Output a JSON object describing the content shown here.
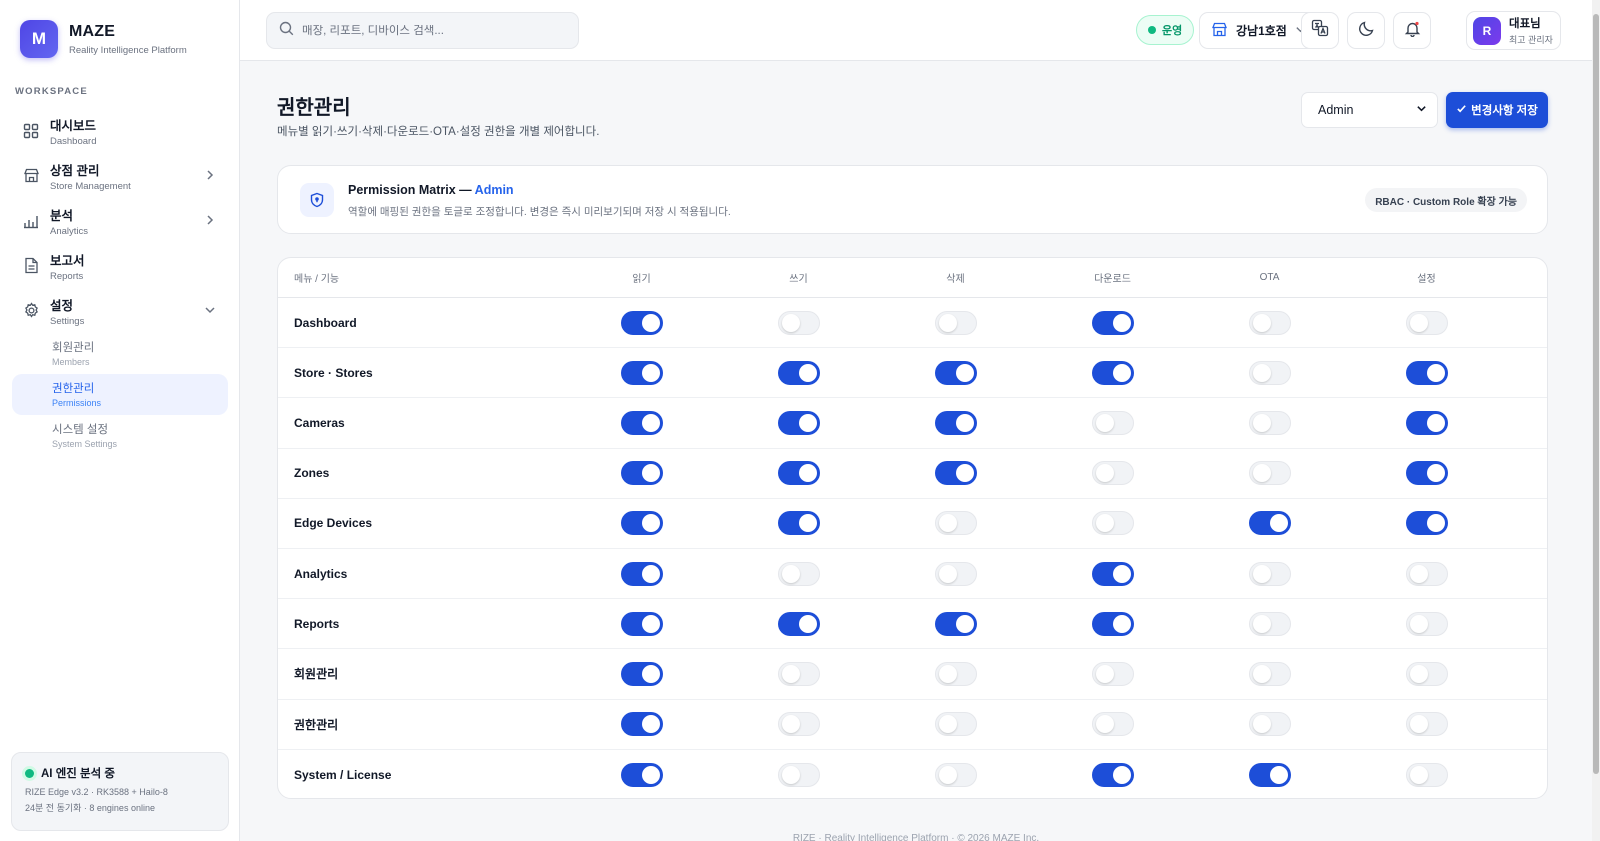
{
  "brand": {
    "logo": "M",
    "name": "MAZE",
    "subtitle": "Reality Intelligence Platform"
  },
  "sidebar": {
    "section_label": "WORKSPACE",
    "items": [
      {
        "title": "대시보드",
        "subtitle": "Dashboard",
        "icon": "grid-icon"
      },
      {
        "title": "상점 관리",
        "subtitle": "Store Management",
        "icon": "store-icon"
      },
      {
        "title": "분석",
        "subtitle": "Analytics",
        "icon": "bar-chart-icon"
      },
      {
        "title": "보고서",
        "subtitle": "Reports",
        "icon": "document-icon"
      },
      {
        "title": "설정",
        "subtitle": "Settings",
        "icon": "gear-icon"
      }
    ],
    "sub_items": [
      {
        "title": "회원관리",
        "subtitle": "Members"
      },
      {
        "title": "권한관리",
        "subtitle": "Permissions",
        "active": true
      },
      {
        "title": "시스템 설정",
        "subtitle": "System Settings"
      }
    ],
    "ai_card": {
      "title": "AI 엔진 분석 중",
      "line1": "RIZE Edge v3.2 · RK3588 + Hailo-8",
      "line2": "24분 전 동기화 · 8 engines online"
    }
  },
  "topbar": {
    "search_placeholder": "매장, 리포트, 디바이스 검색...",
    "status": "운영",
    "store": "강남1호점",
    "user": {
      "initial": "R",
      "name": "대표님",
      "role": "최고 관리자"
    }
  },
  "page": {
    "title": "권한관리",
    "description": "메뉴별 읽기·쓰기·삭제·다운로드·OTA·설정 권한을 개별 제어합니다.",
    "role_selected": "Admin",
    "save_label": "변경사항 저장"
  },
  "info_card": {
    "title_prefix": "Permission Matrix — ",
    "title_role": "Admin",
    "description": "역할에 매핑된 권한을 토글로 조정합니다. 변경은 즉시 미리보기되며 저장 시 적용됩니다.",
    "badge": "RBAC · Custom Role 확장 가능"
  },
  "matrix": {
    "columns": [
      "메뉴 / 기능",
      "읽기",
      "쓰기",
      "삭제",
      "다운로드",
      "OTA",
      "설정"
    ],
    "rows": [
      {
        "name": "Dashboard",
        "perms": [
          true,
          false,
          false,
          true,
          false,
          false
        ]
      },
      {
        "name": "Store · Stores",
        "perms": [
          true,
          true,
          true,
          true,
          false,
          true
        ]
      },
      {
        "name": "Cameras",
        "perms": [
          true,
          true,
          true,
          false,
          false,
          true
        ]
      },
      {
        "name": "Zones",
        "perms": [
          true,
          true,
          true,
          false,
          false,
          true
        ]
      },
      {
        "name": "Edge Devices",
        "perms": [
          true,
          true,
          false,
          false,
          true,
          true
        ]
      },
      {
        "name": "Analytics",
        "perms": [
          true,
          false,
          false,
          true,
          false,
          false
        ]
      },
      {
        "name": "Reports",
        "perms": [
          true,
          true,
          true,
          true,
          false,
          false
        ]
      },
      {
        "name": "회원관리",
        "perms": [
          true,
          false,
          false,
          false,
          false,
          false
        ]
      },
      {
        "name": "권한관리",
        "perms": [
          true,
          false,
          false,
          false,
          false,
          false
        ]
      },
      {
        "name": "System / License",
        "perms": [
          true,
          false,
          false,
          true,
          true,
          false
        ]
      }
    ]
  },
  "footer": "RIZE · Reality Intelligence Platform · © 2026 MAZE Inc.",
  "colors": {
    "accent": "#1d4ed8",
    "brand": "#4f46e5",
    "status_green": "#10b981"
  }
}
